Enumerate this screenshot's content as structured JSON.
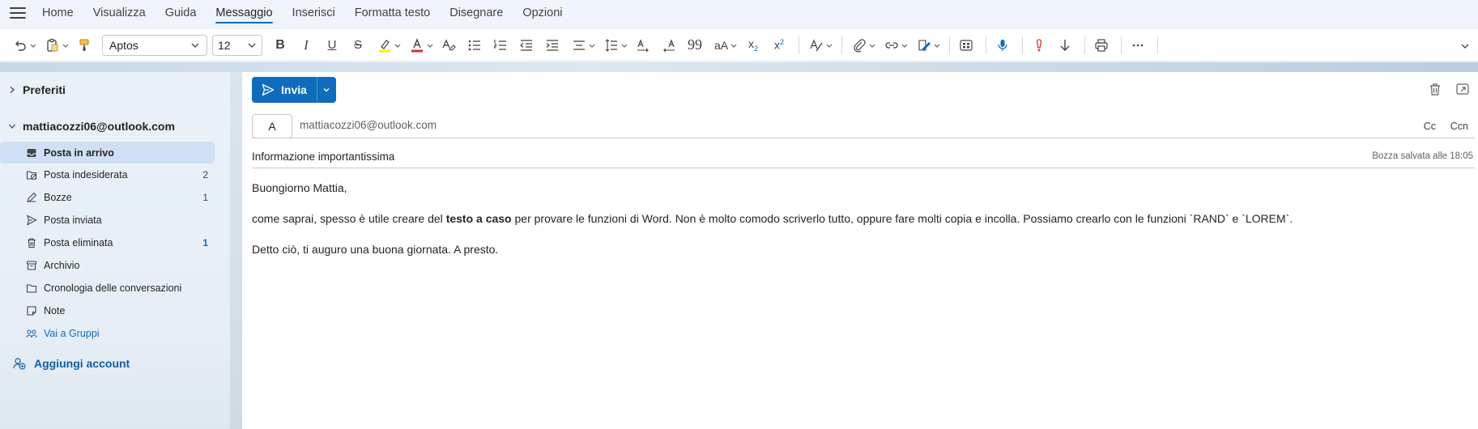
{
  "menu": {
    "tabs": [
      "Home",
      "Visualizza",
      "Guida",
      "Messaggio",
      "Inserisci",
      "Formatta testo",
      "Disegnare",
      "Opzioni"
    ],
    "active": "Messaggio"
  },
  "ribbon": {
    "font_name": "Aptos",
    "font_size": "12"
  },
  "sidebar": {
    "favorites_label": "Preferiti",
    "account_label": "mattiacozzi06@outlook.com",
    "folders": [
      {
        "label": "Posta in arrivo",
        "count": "",
        "icon": "inbox-icon",
        "selected": true
      },
      {
        "label": "Posta indesiderata",
        "count": "2",
        "icon": "junk-icon"
      },
      {
        "label": "Bozze",
        "count": "1",
        "icon": "drafts-icon"
      },
      {
        "label": "Posta inviata",
        "count": "",
        "icon": "sent-icon"
      },
      {
        "label": "Posta eliminata",
        "count": "1",
        "icon": "trash-icon"
      },
      {
        "label": "Archivio",
        "count": "",
        "icon": "archive-icon"
      },
      {
        "label": "Cronologia delle conversazioni",
        "count": "",
        "icon": "folder-icon"
      },
      {
        "label": "Note",
        "count": "",
        "icon": "note-icon"
      },
      {
        "label": "Vai a Gruppi",
        "count": "",
        "icon": "groups-icon"
      }
    ],
    "add_account_label": "Aggiungi account"
  },
  "compose": {
    "send_label": "Invia",
    "to_label": "A",
    "to_value": "mattiacozzi06@outlook.com",
    "cc_label": "Cc",
    "bcc_label": "Ccn",
    "subject": "Informazione importantissima",
    "draft_status": "Bozza salvata alle 18:05",
    "greeting": "Buongiorno Mattia,",
    "para_before_bold": "come saprai, spesso è utile creare del ",
    "para_bold": "testo a caso",
    "para_after_bold": " per provare le funzioni di Word. Non è molto comodo scriverlo tutto, oppure fare molti copia e incolla. Possiamo crearlo con le funzioni `RAND` e `LOREM`.",
    "closing": "Detto ciò, ti auguro una buona giornata. A presto."
  },
  "colors": {
    "accent": "#0f6cbd",
    "selected_folder": "#cfe0f4"
  }
}
